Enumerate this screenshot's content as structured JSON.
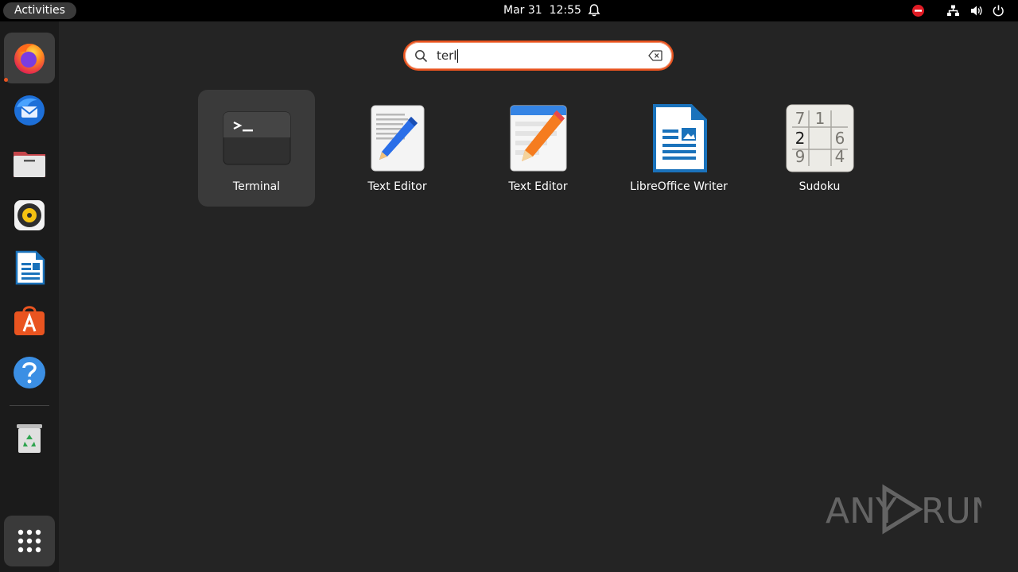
{
  "topbar": {
    "activities_label": "Activities",
    "clock": "Mar 31  12:55",
    "icons": [
      "bell-icon",
      "do-not-disturb-icon",
      "network-icon",
      "volume-icon",
      "power-icon"
    ]
  },
  "dock": {
    "items": [
      {
        "name": "firefox",
        "icon": "firefox-icon",
        "active": true
      },
      {
        "name": "thunderbird",
        "icon": "thunderbird-icon"
      },
      {
        "name": "files",
        "icon": "files-icon"
      },
      {
        "name": "rhythmbox",
        "icon": "rhythmbox-icon"
      },
      {
        "name": "libreoffice-writer",
        "icon": "libreoffice-writer-icon"
      },
      {
        "name": "app-center",
        "icon": "app-center-icon"
      },
      {
        "name": "help",
        "icon": "help-icon"
      },
      {
        "name": "trash",
        "icon": "trash-icon"
      }
    ],
    "show_apps_icon": "apps-grid-icon"
  },
  "search": {
    "value": "terl"
  },
  "results": [
    {
      "label": "Terminal",
      "selected": true
    },
    {
      "label": "Text Editor"
    },
    {
      "label": "Text Editor"
    },
    {
      "label": "LibreOffice Writer"
    },
    {
      "label": "Sudoku"
    }
  ],
  "sudoku_digits": [
    "7",
    "1",
    "2",
    "6",
    "9",
    "4"
  ],
  "watermark": {
    "left": "ANY",
    "right": "RUN"
  },
  "colors": {
    "accent": "#e95420",
    "background": "#242424",
    "topbar": "#000000",
    "dock": "#1b1b1b"
  }
}
